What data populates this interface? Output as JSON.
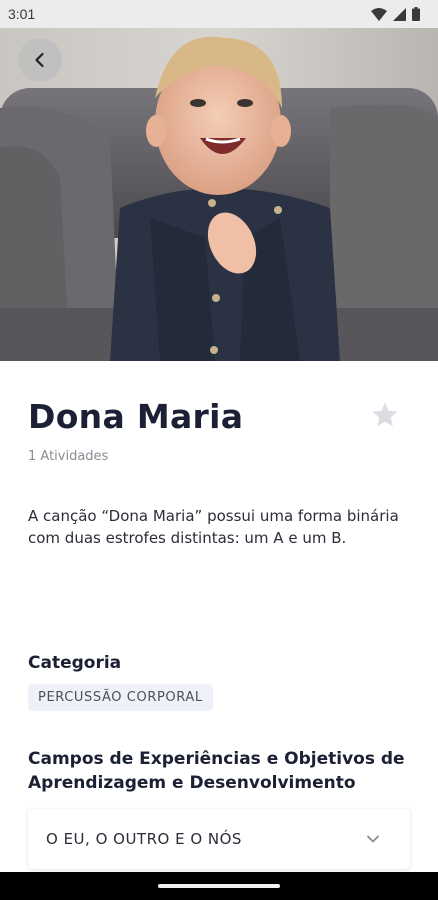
{
  "status_bar": {
    "time": "3:01"
  },
  "hero": {
    "image_alt": "baby-clapping-photo"
  },
  "song": {
    "title": "Dona Maria",
    "activities": "1 Atividades",
    "description": "A canção “Dona Maria” possui uma forma binária com duas estrofes distintas: um A e um B.",
    "favorite_icon": "star-icon"
  },
  "category": {
    "heading": "Categoria",
    "chip": "PERCUSSÃO CORPORAL"
  },
  "fields": {
    "heading": "Campos de Experiências e Objetivos de Aprendizagem e Desenvolvimento",
    "selected": "O EU, O OUTRO E O NÓS"
  },
  "colors": {
    "title": "#1c2034",
    "chip_bg": "#eef1f7",
    "star": "#dcdde2"
  }
}
